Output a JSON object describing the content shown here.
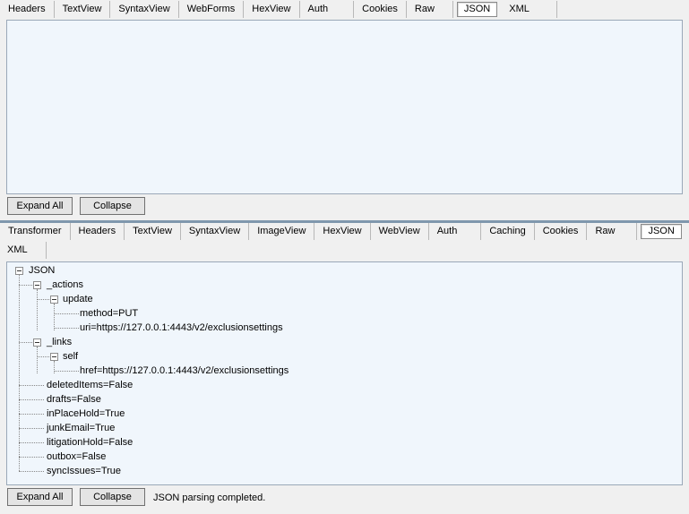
{
  "request": {
    "tabs": [
      "Headers",
      "TextView",
      "SyntaxView",
      "WebForms",
      "HexView",
      "Auth",
      "Cookies",
      "Raw",
      "JSON",
      "XML"
    ],
    "active_tab": "JSON",
    "expand_all_label": "Expand All",
    "collapse_label": "Collapse"
  },
  "response": {
    "tabs_row1": [
      "Transformer",
      "Headers",
      "TextView",
      "SyntaxView",
      "ImageView",
      "HexView",
      "WebView",
      "Auth",
      "Caching",
      "Cookies",
      "Raw",
      "JSON"
    ],
    "tabs_row2": [
      "XML"
    ],
    "active_tab": "JSON",
    "expand_all_label": "Expand All",
    "collapse_label": "Collapse",
    "status": "JSON parsing completed.",
    "tree": {
      "root": "JSON",
      "actions": "_actions",
      "update": "update",
      "method": "method=PUT",
      "uri": "uri=https://127.0.0.1:4443/v2/exclusionsettings",
      "links": "_links",
      "self": "self",
      "href": "href=https://127.0.0.1:4443/v2/exclusionsettings",
      "deletedItems": "deletedItems=False",
      "drafts": "drafts=False",
      "inPlaceHold": "inPlaceHold=True",
      "junkEmail": "junkEmail=True",
      "litigationHold": "litigationHold=False",
      "outbox": "outbox=False",
      "syncIssues": "syncIssues=True"
    }
  }
}
